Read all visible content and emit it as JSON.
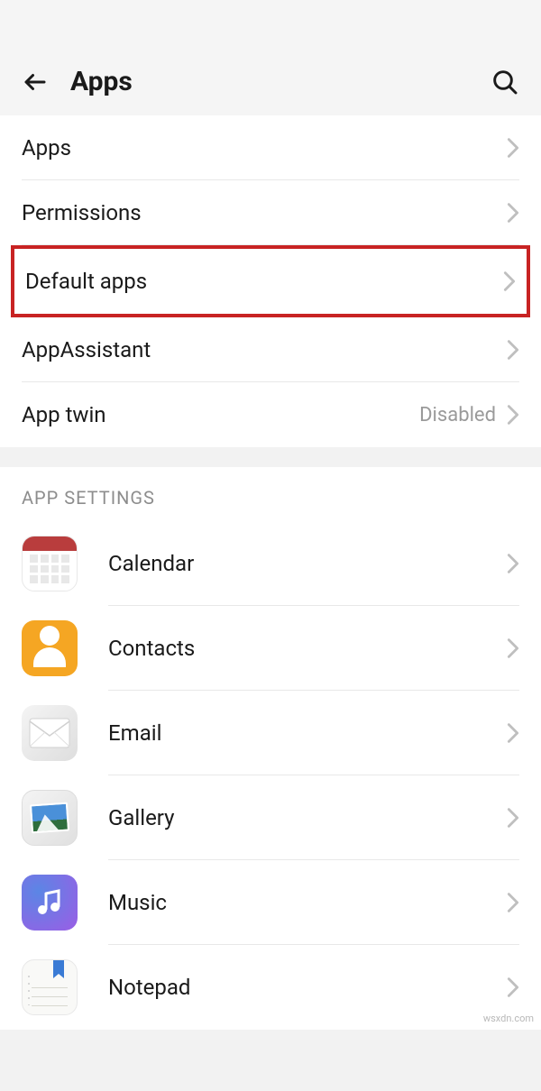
{
  "header": {
    "title": "Apps"
  },
  "menu": {
    "apps": {
      "label": "Apps"
    },
    "permissions": {
      "label": "Permissions"
    },
    "default_apps": {
      "label": "Default apps"
    },
    "app_assistant": {
      "label": "AppAssistant"
    },
    "app_twin": {
      "label": "App twin",
      "value": "Disabled"
    }
  },
  "section_header": "APP SETTINGS",
  "apps": {
    "calendar": {
      "label": "Calendar"
    },
    "contacts": {
      "label": "Contacts"
    },
    "email": {
      "label": "Email"
    },
    "gallery": {
      "label": "Gallery"
    },
    "music": {
      "label": "Music"
    },
    "notepad": {
      "label": "Notepad"
    }
  },
  "watermark": "wsxdn.com"
}
